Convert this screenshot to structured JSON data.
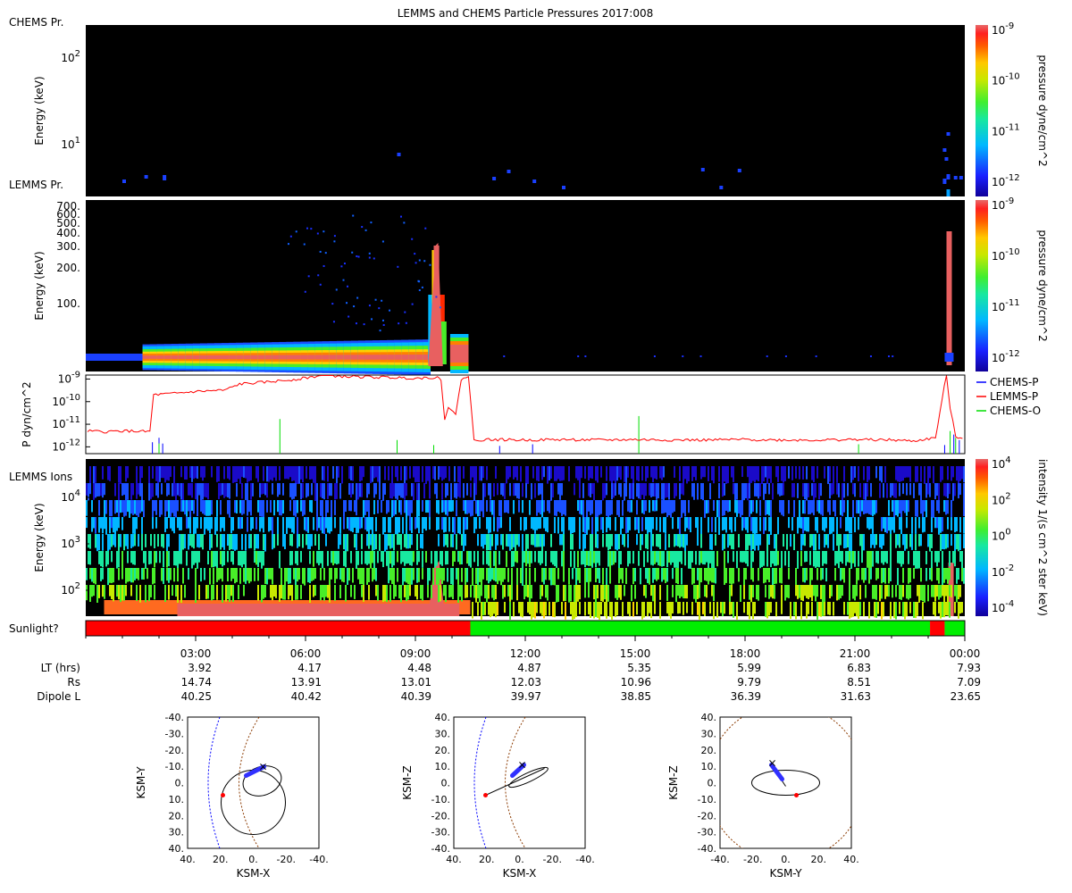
{
  "figure": {
    "title": "LEMMS and CHEMS Particle Pressures  2017:008"
  },
  "colorscale": [
    "#1a0ac8",
    "#1a50ff",
    "#00b8ff",
    "#18e8a0",
    "#48ee28",
    "#c8e800",
    "#ffd000",
    "#ff8000",
    "#ff2800",
    "#e86060"
  ],
  "colors": {
    "panel_bg": "#000000",
    "sun": "#ff0000",
    "shade": "#00ee00",
    "chems_p": "#0000ff",
    "lemms_p": "#ff0000",
    "chems_o": "#00dd00"
  },
  "chart_data": [
    {
      "id": "chems",
      "type": "heatmap",
      "panel_label": "CHEMS Pr.",
      "ylabel": "Energy (keV)",
      "yscale": "log",
      "yticks": [
        "10^1",
        "10^2"
      ],
      "colorbar": {
        "label": "pressure dyne/cm^2",
        "ticks": [
          "10^-12",
          "10^-11",
          "10^-10",
          "10^-9"
        ]
      }
    },
    {
      "id": "lemms",
      "type": "heatmap",
      "panel_label": "LEMMS Pr.",
      "ylabel": "Energy (keV)",
      "yscale": "log",
      "yticks": [
        "100.",
        "200.",
        "300.",
        "400.",
        "500.",
        "600.",
        "700."
      ],
      "colorbar": {
        "label": "pressure dyne/cm^2",
        "ticks": [
          "10^-12",
          "10^-11",
          "10^-10",
          "10^-9"
        ]
      }
    },
    {
      "id": "pressure",
      "type": "line",
      "ylabel": "P dyn/cm^2",
      "yscale": "log",
      "yticks": [
        "10^-12",
        "10^-11",
        "10^-10",
        "10^-9"
      ],
      "ylim": [
        5e-13,
        1.5e-09
      ],
      "xlim": [
        0,
        24
      ],
      "series": [
        {
          "name": "CHEMS-P",
          "color": "#0000ff",
          "spikes": [
            [
              1.82,
              1.6e-12
            ],
            [
              2.0,
              2.5e-12
            ],
            [
              2.1,
              1.4e-12
            ],
            [
              11.3,
              1.1e-12
            ],
            [
              12.2,
              1.3e-12
            ],
            [
              23.45,
              1.2e-12
            ],
            [
              23.7,
              3.5e-12
            ],
            [
              23.85,
              2e-12
            ]
          ]
        },
        {
          "name": "LEMMS-P",
          "color": "#ff0000",
          "points": [
            [
              0.05,
              5e-12
            ],
            [
              0.5,
              4.6e-12
            ],
            [
              1.0,
              5.1e-12
            ],
            [
              1.5,
              4.8e-12
            ],
            [
              1.75,
              4.7e-12
            ],
            [
              1.85,
              2e-10
            ],
            [
              2.3,
              2.2e-10
            ],
            [
              3.0,
              2.8e-10
            ],
            [
              3.8,
              3.2e-10
            ],
            [
              4.2,
              6e-10
            ],
            [
              5.0,
              7.5e-10
            ],
            [
              5.8,
              1e-09
            ],
            [
              6.5,
              1.5e-09
            ],
            [
              7.0,
              1.3e-09
            ],
            [
              8.0,
              1.2e-09
            ],
            [
              9.0,
              1.1e-09
            ],
            [
              9.6,
              1.2e-09
            ],
            [
              9.7,
              8e-10
            ],
            [
              9.8,
              1.8e-11
            ],
            [
              9.9,
              6e-11
            ],
            [
              10.1,
              2.5e-11
            ],
            [
              10.25,
              1e-09
            ],
            [
              10.45,
              1.3e-09
            ],
            [
              10.6,
              2e-12
            ],
            [
              11.0,
              2.1e-12
            ],
            [
              12.0,
              2e-12
            ],
            [
              13.0,
              2.1e-12
            ],
            [
              14.0,
              2e-12
            ],
            [
              15.0,
              2.1e-12
            ],
            [
              16.0,
              2e-12
            ],
            [
              17.0,
              2e-12
            ],
            [
              18.0,
              2.1e-12
            ],
            [
              19.0,
              2e-12
            ],
            [
              20.0,
              2e-12
            ],
            [
              21.0,
              2.1e-12
            ],
            [
              22.0,
              2e-12
            ],
            [
              22.6,
              1.8e-12
            ],
            [
              23.2,
              2.5e-12
            ],
            [
              23.5,
              1.6e-09
            ],
            [
              23.6,
              5e-11
            ],
            [
              23.75,
              3e-12
            ],
            [
              24.0,
              2.2e-12
            ]
          ]
        },
        {
          "name": "CHEMS-O",
          "color": "#00dd00",
          "spikes": [
            [
              2.0,
              1.4e-12
            ],
            [
              5.3,
              1.7e-11
            ],
            [
              8.5,
              2e-12
            ],
            [
              9.5,
              1.2e-12
            ],
            [
              15.1,
              2.3e-11
            ],
            [
              21.1,
              1.3e-12
            ],
            [
              23.6,
              5e-12
            ],
            [
              23.75,
              2.5e-12
            ]
          ]
        }
      ]
    },
    {
      "id": "ions",
      "type": "heatmap",
      "panel_label": "LEMMS Ions",
      "ylabel": "Energy (keV)",
      "yscale": "log",
      "yticks": [
        "10^2",
        "10^3",
        "10^4"
      ],
      "colorbar": {
        "label": "intensity 1/(s cm^2 ster keV)",
        "ticks": [
          "10^-4",
          "10^-2",
          "10^0",
          "10^2",
          "10^4"
        ]
      }
    },
    {
      "id": "sunlight",
      "type": "bar",
      "label": "Sunlight?",
      "segments": [
        {
          "from": 0,
          "to": 10.5,
          "state": "sun"
        },
        {
          "from": 10.5,
          "to": 23.05,
          "state": "shade"
        },
        {
          "from": 23.05,
          "to": 23.45,
          "state": "sun"
        },
        {
          "from": 23.45,
          "to": 24,
          "state": "shade"
        }
      ]
    }
  ],
  "time_axis": {
    "ticks": [
      "03:00",
      "06:00",
      "09:00",
      "12:00",
      "15:00",
      "18:00",
      "21:00",
      "00:00"
    ],
    "rows": [
      {
        "label": "LT (hrs)",
        "values": [
          "3.92",
          "4.17",
          "4.48",
          "4.87",
          "5.35",
          "5.99",
          "6.83",
          "7.93"
        ]
      },
      {
        "label": "Rs",
        "values": [
          "14.74",
          "13.91",
          "13.01",
          "12.03",
          "10.96",
          "9.79",
          "8.51",
          "7.09"
        ]
      },
      {
        "label": "Dipole L",
        "values": [
          "40.25",
          "40.42",
          "40.39",
          "39.97",
          "38.85",
          "36.39",
          "31.63",
          "23.65"
        ]
      }
    ]
  },
  "orbits": [
    {
      "xlabel": "KSM-X",
      "ylabel": "KSM-Y",
      "xticks": [
        "40.",
        "20.",
        "0.",
        "-20.",
        "-40."
      ],
      "yticks": [
        "-40.",
        "-30.",
        "-20.",
        "-10.",
        "0.",
        "10.",
        "20.",
        "30.",
        "40."
      ]
    },
    {
      "xlabel": "KSM-X",
      "ylabel": "KSM-Z",
      "xticks": [
        "40.",
        "20.",
        "0.",
        "-20.",
        "-40."
      ],
      "yticks": [
        "40.",
        "30.",
        "20.",
        "10.",
        "0.",
        "-10.",
        "-20.",
        "-30.",
        "-40."
      ]
    },
    {
      "xlabel": "KSM-Y",
      "ylabel": "KSM-Z",
      "xticks": [
        "-40.",
        "-20.",
        "0.",
        "20.",
        "40."
      ],
      "yticks": [
        "40.",
        "30.",
        "20.",
        "10.",
        "0.",
        "-10.",
        "-20.",
        "-30.",
        "-40."
      ]
    }
  ]
}
